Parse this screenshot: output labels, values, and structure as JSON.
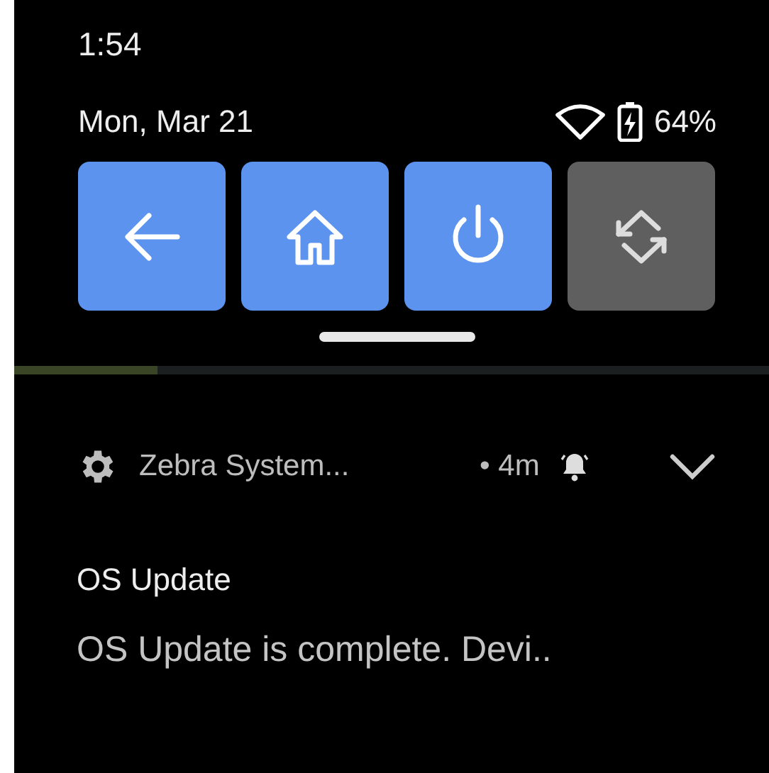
{
  "status_bar": {
    "time": "1:54"
  },
  "header": {
    "date": "Mon, Mar 21",
    "battery": "64%"
  },
  "tiles": [
    {
      "kind": "back",
      "on": true
    },
    {
      "kind": "home",
      "on": true
    },
    {
      "kind": "power",
      "on": true
    },
    {
      "kind": "rotate",
      "on": false
    }
  ],
  "progress": {
    "level": 0.19
  },
  "notification": {
    "app": "Zebra System...",
    "time": "• 4m",
    "expanded": false,
    "title": "OS Update",
    "text": "OS Update is complete. Devi.."
  }
}
